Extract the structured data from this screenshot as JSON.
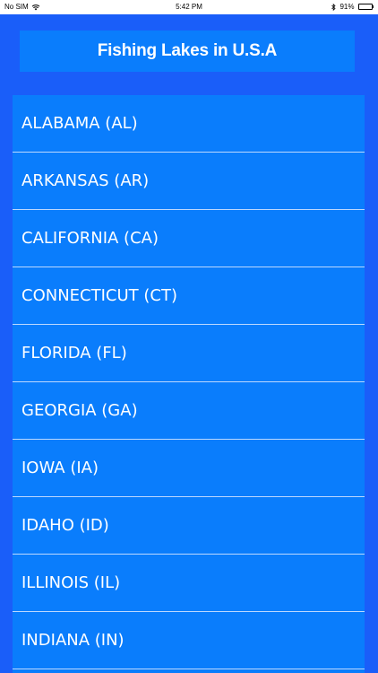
{
  "status_bar": {
    "carrier": "No SIM",
    "time": "5:42 PM",
    "battery_percent": "91%",
    "battery_level": 0.91,
    "wifi_icon": "wifi-icon",
    "bluetooth_icon": "bluetooth-icon"
  },
  "header": {
    "title": "Fishing Lakes in U.S.A"
  },
  "states": [
    {
      "label": "ALABAMA (AL)"
    },
    {
      "label": "ARKANSAS (AR)"
    },
    {
      "label": "CALIFORNIA (CA)"
    },
    {
      "label": "CONNECTICUT (CT)"
    },
    {
      "label": "FLORIDA (FL)"
    },
    {
      "label": "GEORGIA (GA)"
    },
    {
      "label": "IOWA (IA)"
    },
    {
      "label": "IDAHO (ID)"
    },
    {
      "label": "ILLINOIS (IL)"
    },
    {
      "label": "INDIANA (IN)"
    }
  ],
  "colors": {
    "background": "#1a5ef9",
    "panel": "#0a7dfc",
    "text": "#ffffff",
    "separator": "#bcd8ff"
  }
}
